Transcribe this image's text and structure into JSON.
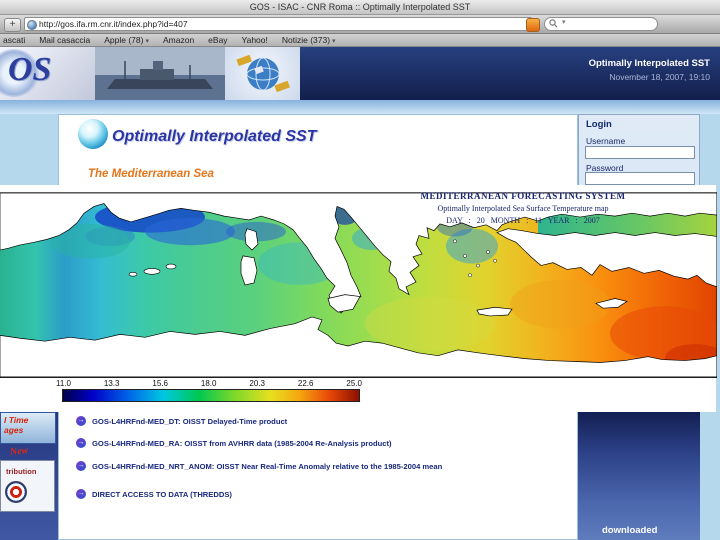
{
  "browser": {
    "window_title": "GOS - ISAC - CNR Roma :: Optimally Interpolated SST",
    "plus_button": "+",
    "url": "http://gos.ifa.rm.cnr.it/index.php?id=407",
    "bookmarks": [
      "ascati",
      "Mail casaccia",
      "Apple (78)",
      "Amazon",
      "eBay",
      "Yahoo!",
      "Notizie (373)"
    ]
  },
  "site_header": {
    "logo_text": "OS",
    "banner_title": "Optimally Interpolated SST",
    "banner_datetime": "November 18, 2007, 19:10"
  },
  "content": {
    "page_title": "Optimally Interpolated SST",
    "page_subtitle": "The Mediterranean Sea",
    "links": [
      "GOS-L4HRFnd-MED_DT: OISST Delayed-Time product",
      "GOS-L4HRFnd-MED_RA: OISST from AVHRR data (1985-2004 Re-Analysis product)",
      "GOS-L4HRFnd-MED_NRT_ANOM: OISST Near Real-Time Anomaly relative to the 1985-2004 mean",
      "DIRECT ACCESS TO DATA (THREDDS)"
    ]
  },
  "login": {
    "title": "Login",
    "username_label": "Username",
    "password_label": "Password"
  },
  "map": {
    "title": "MEDITERRANEAN FORECASTING SYSTEM",
    "subtitle": "Optimally Interpolated Sea Surface Temperature map",
    "date_line": "DAY : 20 MONTH : 11 YEAR : 2007",
    "scale_labels": [
      "11.0",
      "13.3",
      "15.6",
      "18.0",
      "20.3",
      "22.6",
      "25.0"
    ]
  },
  "sidebar": {
    "frag1_line1": "l Time",
    "frag1_line2": "ages",
    "frag1_badge": "New",
    "frag2_label": "tribution"
  },
  "right_panel": {
    "downloaded_label": "downloaded"
  },
  "colors": {
    "accent_navy": "#1b2a66",
    "link_blue": "#18287e",
    "subtitle_orange": "#e4761c"
  }
}
